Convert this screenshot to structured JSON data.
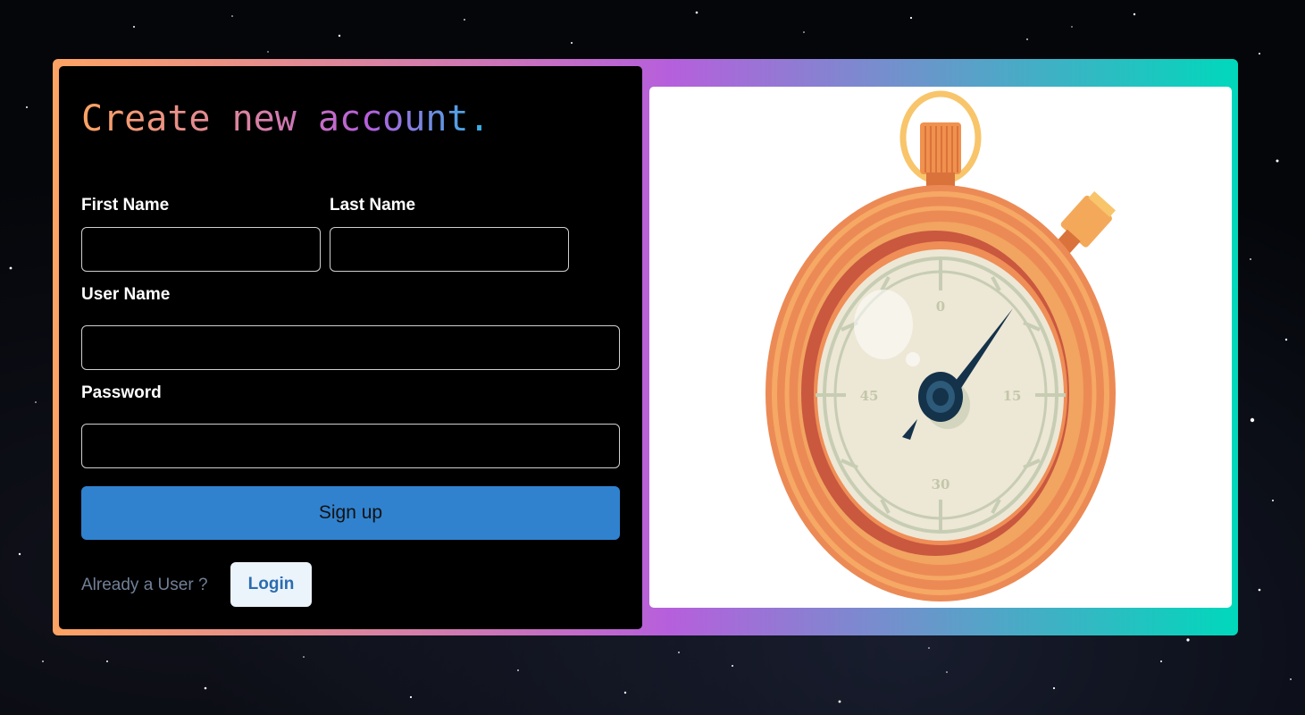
{
  "heading": "Create new account.",
  "form": {
    "first_name_label": "First Name",
    "last_name_label": "Last Name",
    "user_name_label": "User Name",
    "password_label": "Password",
    "first_name_value": "",
    "last_name_value": "",
    "user_name_value": "",
    "password_value": "",
    "signup_label": "Sign up"
  },
  "footer": {
    "already_text": "Already a User ?",
    "login_label": "Login"
  },
  "illustration": {
    "name": "stopwatch-illustration",
    "dial_numbers": [
      "0",
      "15",
      "30",
      "45"
    ]
  },
  "colors": {
    "gradient_start": "#fda363",
    "gradient_mid": "#b65fdc",
    "gradient_end": "#00d8bb",
    "primary_button": "#3182ce",
    "login_button_bg": "#ebf4fb",
    "login_button_text": "#2b6cb0"
  }
}
